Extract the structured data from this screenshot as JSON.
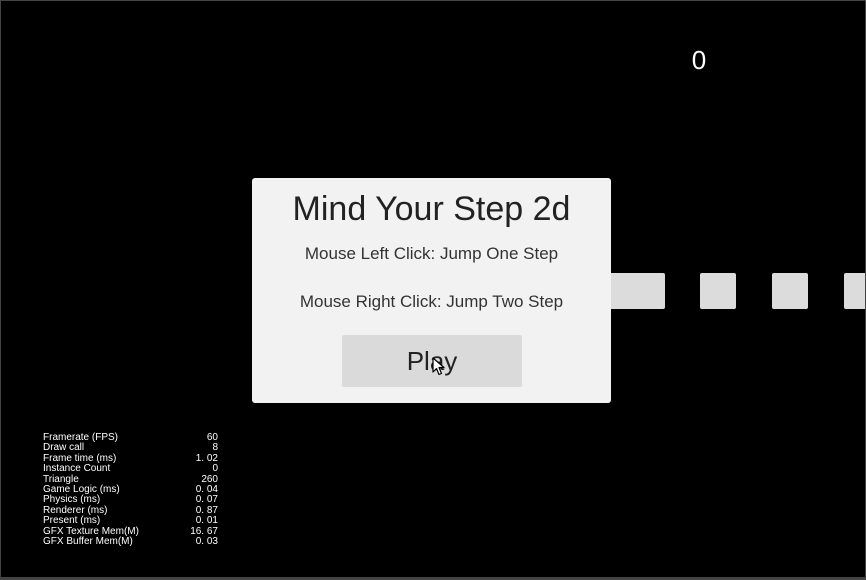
{
  "game": {
    "score": "0",
    "title": "Mind Your Step 2d",
    "instruction_left": "Mouse Left Click: Jump One Step",
    "instruction_right": "Mouse Right Click: Jump Two Step",
    "play_label": "Play"
  },
  "stats": [
    {
      "label": "Framerate (FPS)",
      "value": "60"
    },
    {
      "label": "Draw call",
      "value": "8"
    },
    {
      "label": "Frame time (ms)",
      "value": "1. 02"
    },
    {
      "label": "Instance Count",
      "value": "0"
    },
    {
      "label": "Triangle",
      "value": "260"
    },
    {
      "label": "Game Logic (ms)",
      "value": "0. 04"
    },
    {
      "label": "Physics (ms)",
      "value": "0. 07"
    },
    {
      "label": "Renderer (ms)",
      "value": "0. 87"
    },
    {
      "label": "Present (ms)",
      "value": "0. 01"
    },
    {
      "label": "GFX Texture Mem(M)",
      "value": "16. 67"
    },
    {
      "label": "GFX Buffer Mem(M)",
      "value": "0. 03"
    }
  ],
  "colors": {
    "background": "#000000",
    "panel": "#f2f2f2",
    "button": "#dadada",
    "block": "#dcdcdc",
    "text": "#ffffff"
  },
  "icons": {
    "cursor": "mouse-pointer-icon"
  }
}
